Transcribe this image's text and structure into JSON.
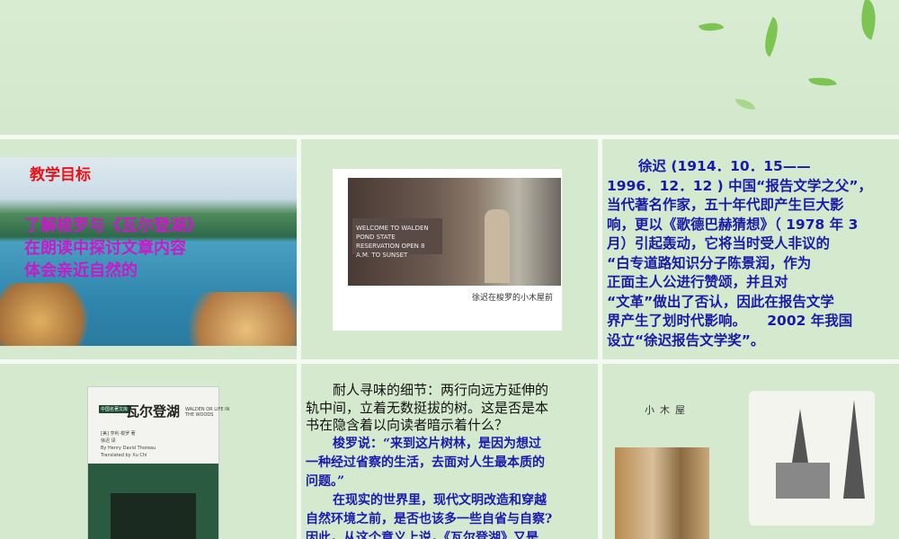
{
  "slide1": {
    "title": "教学目标",
    "goals": [
      "了解梭罗与《瓦尔登湖》",
      "在朗读中探讨文章内容",
      "体会亲近自然的"
    ]
  },
  "slide2": {
    "sign_text": "WELCOME TO WALDEN POND STATE RESERVATION OPEN 8 A.M. TO SUNSET",
    "caption": "徐迟在梭罗的小木屋前"
  },
  "slide3": {
    "bio": [
      "徐迟 (1914．10．15——",
      "1996．12．12 ) 中国“报告文学之父”，",
      "当代著名作家，五十年代即产生巨大影",
      "响，更以《歌德巴赫猜想》（ 1978 年 3",
      "月）引起轰动，它将当时受人非议的",
      "“白专道路知识分子陈景润，作为",
      "正面主人公进行赞颂，并且对",
      "“文革”做出了否认，因此在报告文学",
      "界产生了划时代影响。　　2002 年我国",
      "设立“徐迟报告文学奖”。"
    ]
  },
  "slide4": {
    "series": "中国名著文库",
    "title": "瓦尔登湖",
    "subtitle": "WALDEN OR LIFE IN THE WOODS",
    "author": "[美] 亨利·梭罗 著",
    "translator": "徐迟 译",
    "author_en": "By Henry David Thoreau",
    "translator_en": "Translated by Xu Chi"
  },
  "slide5": {
    "p1": "耐人寻味的细节：两行向远方延伸的",
    "p2": "轨中间，立着无数挺拔的树。这是否是本",
    "p3": "书在隐含着以向读者暗示着什么？",
    "q1": "梭罗说：“来到这片树林，是因为想过",
    "q2": "一种经过省察的生活，去面对人生最本质的",
    "q3": "问题。”",
    "r1": "在现实的世界里，现代文明改造和穿越",
    "r2": "自然环境之前，是否也该多一些自省与自察?",
    "r3": "因此，从这个意义上说，《瓦尔登湖》又是"
  },
  "slide6": {
    "label": "小木屋"
  }
}
